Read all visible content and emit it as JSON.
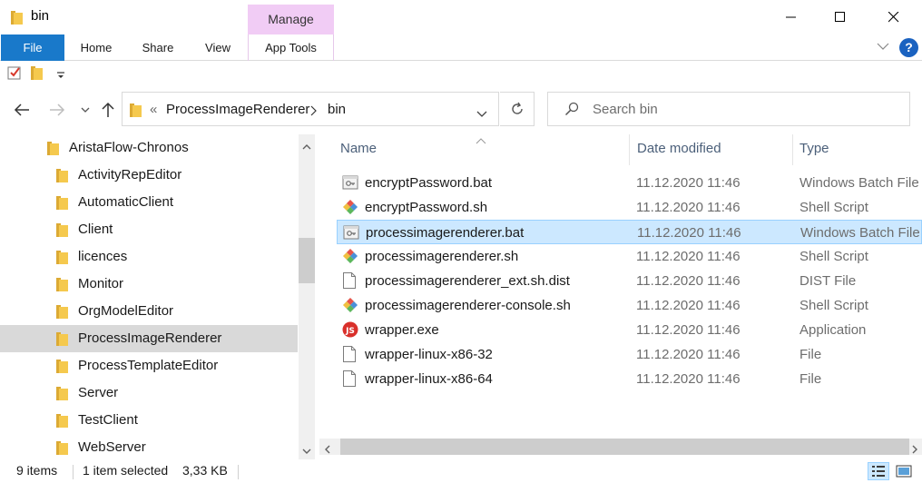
{
  "window": {
    "title": "bin",
    "context_tab": "Manage"
  },
  "ribbon": {
    "tabs": [
      "File",
      "Home",
      "Share",
      "View",
      "App Tools"
    ]
  },
  "address": {
    "overflow": "«",
    "crumbs": [
      "ProcessImageRenderer",
      "bin"
    ]
  },
  "search": {
    "placeholder": "Search bin"
  },
  "nav": {
    "items": [
      {
        "label": "AristaFlow-Chronos",
        "selected": false
      },
      {
        "label": "ActivityRepEditor",
        "selected": false
      },
      {
        "label": "AutomaticClient",
        "selected": false
      },
      {
        "label": "Client",
        "selected": false
      },
      {
        "label": "licences",
        "selected": false
      },
      {
        "label": "Monitor",
        "selected": false
      },
      {
        "label": "OrgModelEditor",
        "selected": false
      },
      {
        "label": "ProcessImageRenderer",
        "selected": true
      },
      {
        "label": "ProcessTemplateEditor",
        "selected": false
      },
      {
        "label": "Server",
        "selected": false
      },
      {
        "label": "TestClient",
        "selected": false
      },
      {
        "label": "WebServer",
        "selected": false
      }
    ]
  },
  "columns": {
    "name": "Name",
    "date": "Date modified",
    "type": "Type"
  },
  "files": [
    {
      "name": "encryptPassword.bat",
      "date": "11.12.2020 11:46",
      "type": "Windows Batch File",
      "icon": "batch-file-icon",
      "selected": false
    },
    {
      "name": "encryptPassword.sh",
      "date": "11.12.2020 11:46",
      "type": "Shell Script",
      "icon": "shell-script-icon",
      "selected": false
    },
    {
      "name": "processimagerenderer.bat",
      "date": "11.12.2020 11:46",
      "type": "Windows Batch File",
      "icon": "batch-file-icon",
      "selected": true
    },
    {
      "name": "processimagerenderer.sh",
      "date": "11.12.2020 11:46",
      "type": "Shell Script",
      "icon": "shell-script-icon",
      "selected": false
    },
    {
      "name": "processimagerenderer_ext.sh.dist",
      "date": "11.12.2020 11:46",
      "type": "DIST File",
      "icon": "generic-file-icon",
      "selected": false
    },
    {
      "name": "processimagerenderer-console.sh",
      "date": "11.12.2020 11:46",
      "type": "Shell Script",
      "icon": "shell-script-icon",
      "selected": false
    },
    {
      "name": "wrapper.exe",
      "date": "11.12.2020 11:46",
      "type": "Application",
      "icon": "wrapper-exe-icon",
      "selected": false
    },
    {
      "name": "wrapper-linux-x86-32",
      "date": "11.12.2020 11:46",
      "type": "File",
      "icon": "generic-file-icon",
      "selected": false
    },
    {
      "name": "wrapper-linux-x86-64",
      "date": "11.12.2020 11:46",
      "type": "File",
      "icon": "generic-file-icon",
      "selected": false
    }
  ],
  "status": {
    "items": "9 items",
    "selection": "1 item selected",
    "size": "3,33 KB"
  },
  "colors": {
    "accent": "#1979ca",
    "manage_tab": "#f1ccf5",
    "selection_bg": "#cce8ff",
    "selection_border": "#99d1ff",
    "folder": "#f0c04a"
  }
}
